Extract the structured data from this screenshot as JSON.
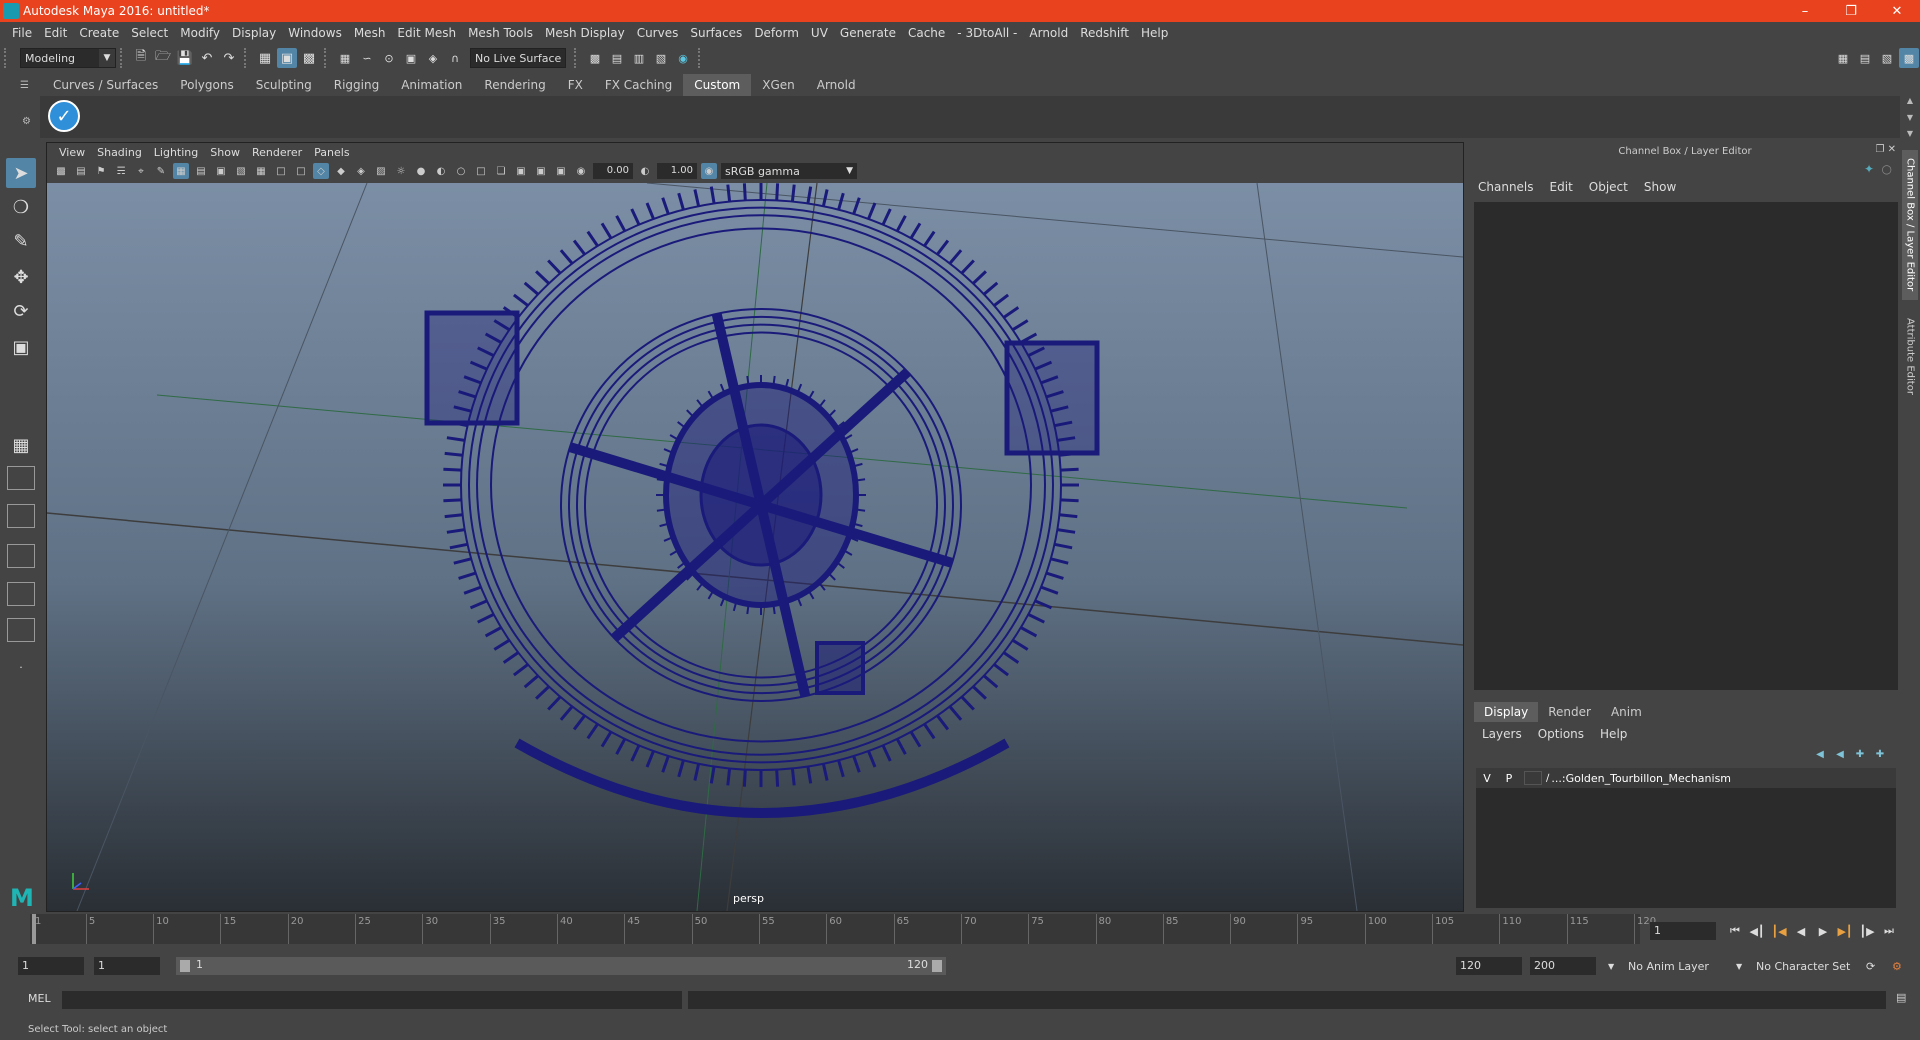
{
  "window": {
    "title": "Autodesk Maya 2016: untitled*",
    "accent": "#e8421e"
  },
  "menubar": [
    "File",
    "Edit",
    "Create",
    "Select",
    "Modify",
    "Display",
    "Windows",
    "Mesh",
    "Edit Mesh",
    "Mesh Tools",
    "Mesh Display",
    "Curves",
    "Surfaces",
    "Deform",
    "UV",
    "Generate",
    "Cache",
    "- 3DtoAll -",
    "Arnold",
    "Redshift",
    "Help"
  ],
  "statusline": {
    "mode": "Modeling",
    "live_surface": "No Live Surface"
  },
  "shelf": {
    "tabs": [
      "Curves / Surfaces",
      "Polygons",
      "Sculpting",
      "Rigging",
      "Animation",
      "Rendering",
      "FX",
      "FX Caching",
      "Custom",
      "XGen",
      "Arnold"
    ],
    "active_tab": "Custom",
    "button_icon": "checkmark-circle-icon"
  },
  "viewport": {
    "menu": [
      "View",
      "Shading",
      "Lighting",
      "Show",
      "Renderer",
      "Panels"
    ],
    "exposure": "0.00",
    "gamma": "1.00",
    "color_space": "sRGB gamma",
    "camera_label": "persp",
    "wireframe_color": "#1a1a7a"
  },
  "channel_box": {
    "title": "Channel Box / Layer Editor",
    "menu": [
      "Channels",
      "Edit",
      "Object",
      "Show"
    ],
    "layer_tabs": [
      "Display",
      "Render",
      "Anim"
    ],
    "active_layer_tab": "Display",
    "layer_menu": [
      "Layers",
      "Options",
      "Help"
    ],
    "layers": [
      {
        "v": "V",
        "p": "P",
        "name": "...:Golden_Tourbillon_Mechanism"
      }
    ]
  },
  "side_tabs": [
    "Channel Box / Layer Editor",
    "Attribute Editor"
  ],
  "timeslider": {
    "ticks": [
      "1",
      "5",
      "10",
      "15",
      "20",
      "25",
      "30",
      "35",
      "40",
      "45",
      "50",
      "55",
      "60",
      "65",
      "70",
      "75",
      "80",
      "85",
      "90",
      "95",
      "100",
      "105",
      "110",
      "115",
      "120"
    ],
    "current_frame": "1"
  },
  "range": {
    "start": "1",
    "playback_start": "1",
    "bar_start": "1",
    "bar_end": "120",
    "playback_end": "120",
    "end": "200",
    "anim_layer": "No Anim Layer",
    "character_set": "No Character Set"
  },
  "command_line": {
    "label": "MEL"
  },
  "help_line": "Select Tool: select an object"
}
